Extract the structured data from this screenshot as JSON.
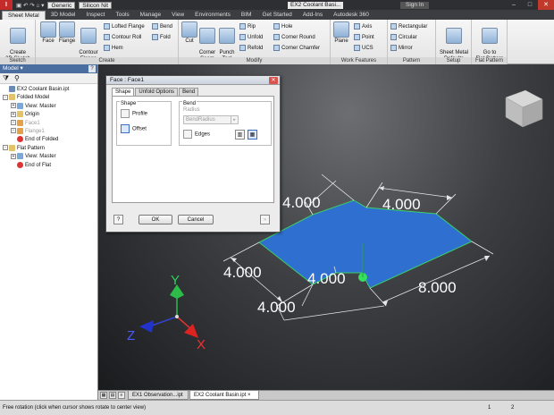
{
  "titlebar": {
    "appearance_combo": "Generic",
    "material_combo": "Silicon Nit",
    "window_title": "EX2 Coolant Basi...",
    "sign_in": "Sign In"
  },
  "menu_tabs": [
    "Sheet Metal",
    "3D Model",
    "Inspect",
    "Tools",
    "Manage",
    "View",
    "Environments",
    "BIM",
    "Get Started",
    "Add-Ins",
    "Autodesk 360"
  ],
  "ribbon": {
    "sketch": {
      "label": "Sketch",
      "create_2d_sketch": "Create\n2D Sketch"
    },
    "create": {
      "label": "Create",
      "face": "Face",
      "flange": "Flange",
      "contour_flange": "Contour\nFlange",
      "lofted_flange": "Lofted Flange",
      "contour_roll": "Contour Roll",
      "hem": "Hem",
      "bend": "Bend",
      "fold": "Fold"
    },
    "modify": {
      "label": "Modify",
      "cut": "Cut",
      "corner_seam": "Corner\nSeam",
      "punch_tool": "Punch\nTool",
      "rip": "Rip",
      "unfold": "Unfold",
      "refold": "Refold",
      "hole": "Hole",
      "corner_round": "Corner Round",
      "corner_chamfer": "Corner Chamfer"
    },
    "work_features": {
      "label": "Work Features",
      "plane": "Plane",
      "axis": "Axis",
      "point": "Point",
      "ucs": "UCS"
    },
    "pattern": {
      "label": "Pattern",
      "rectangular": "Rectangular",
      "circular": "Circular",
      "mirror": "Mirror"
    },
    "setup": {
      "label": "Setup",
      "sheet_metal_defaults": "Sheet Metal\nDefaults"
    },
    "flat_pattern": {
      "label": "Flat Pattern",
      "go_to_flat_pattern": "Go to\nFlat Pattern"
    }
  },
  "browser": {
    "title": "Model",
    "items": [
      {
        "label": "EX2 Coolant Basin.ipt",
        "depth": 0,
        "icon": "part",
        "expander": "",
        "grey": false
      },
      {
        "label": "Folded Model",
        "depth": 0,
        "icon": "folder",
        "expander": "-",
        "grey": false
      },
      {
        "label": "View: Master",
        "depth": 1,
        "icon": "view",
        "expander": "+",
        "grey": false
      },
      {
        "label": "Origin",
        "depth": 1,
        "icon": "folder",
        "expander": "+",
        "grey": false
      },
      {
        "label": "Face1",
        "depth": 1,
        "icon": "face",
        "expander": "+",
        "grey": true
      },
      {
        "label": "Flange1",
        "depth": 1,
        "icon": "face",
        "expander": "+",
        "grey": true
      },
      {
        "label": "End of Folded",
        "depth": 1,
        "icon": "end",
        "expander": "",
        "grey": false
      },
      {
        "label": "Flat Pattern",
        "depth": 0,
        "icon": "folder",
        "expander": "-",
        "grey": false
      },
      {
        "label": "View: Master",
        "depth": 1,
        "icon": "view",
        "expander": "+",
        "grey": false
      },
      {
        "label": "End of Flat",
        "depth": 1,
        "icon": "end",
        "expander": "",
        "grey": false
      }
    ]
  },
  "dialog": {
    "title": "Face : Face1",
    "tabs": [
      "Shape",
      "Unfold Options",
      "Bend"
    ],
    "shape_group": "Shape",
    "profile": "Profile",
    "offset": "Offset",
    "bend_group": "Bend",
    "radius_label": "Radius",
    "radius_value": "BendRadius",
    "edges": "Edges",
    "ok": "OK",
    "cancel": "Cancel"
  },
  "dimensions": {
    "top_left": "4.000",
    "top_right": "4.000",
    "left_side": "4.000",
    "notch": "4.000",
    "right_bottom": "8.000",
    "bottom": "4.000"
  },
  "triad": {
    "x": "X",
    "y": "Y",
    "z": "Z"
  },
  "doc_tabs": [
    "EX1 Observation...ipt",
    "EX2 Coolant Basin.ipt"
  ],
  "status": {
    "text": "Free rotation (click when cursor shows rotate to center view)",
    "count1": "1",
    "count2": "2"
  },
  "colors": {
    "face": "#2f6fd0",
    "edge": "#3ad06a",
    "ribbon_blue": "#4a6ea0"
  }
}
